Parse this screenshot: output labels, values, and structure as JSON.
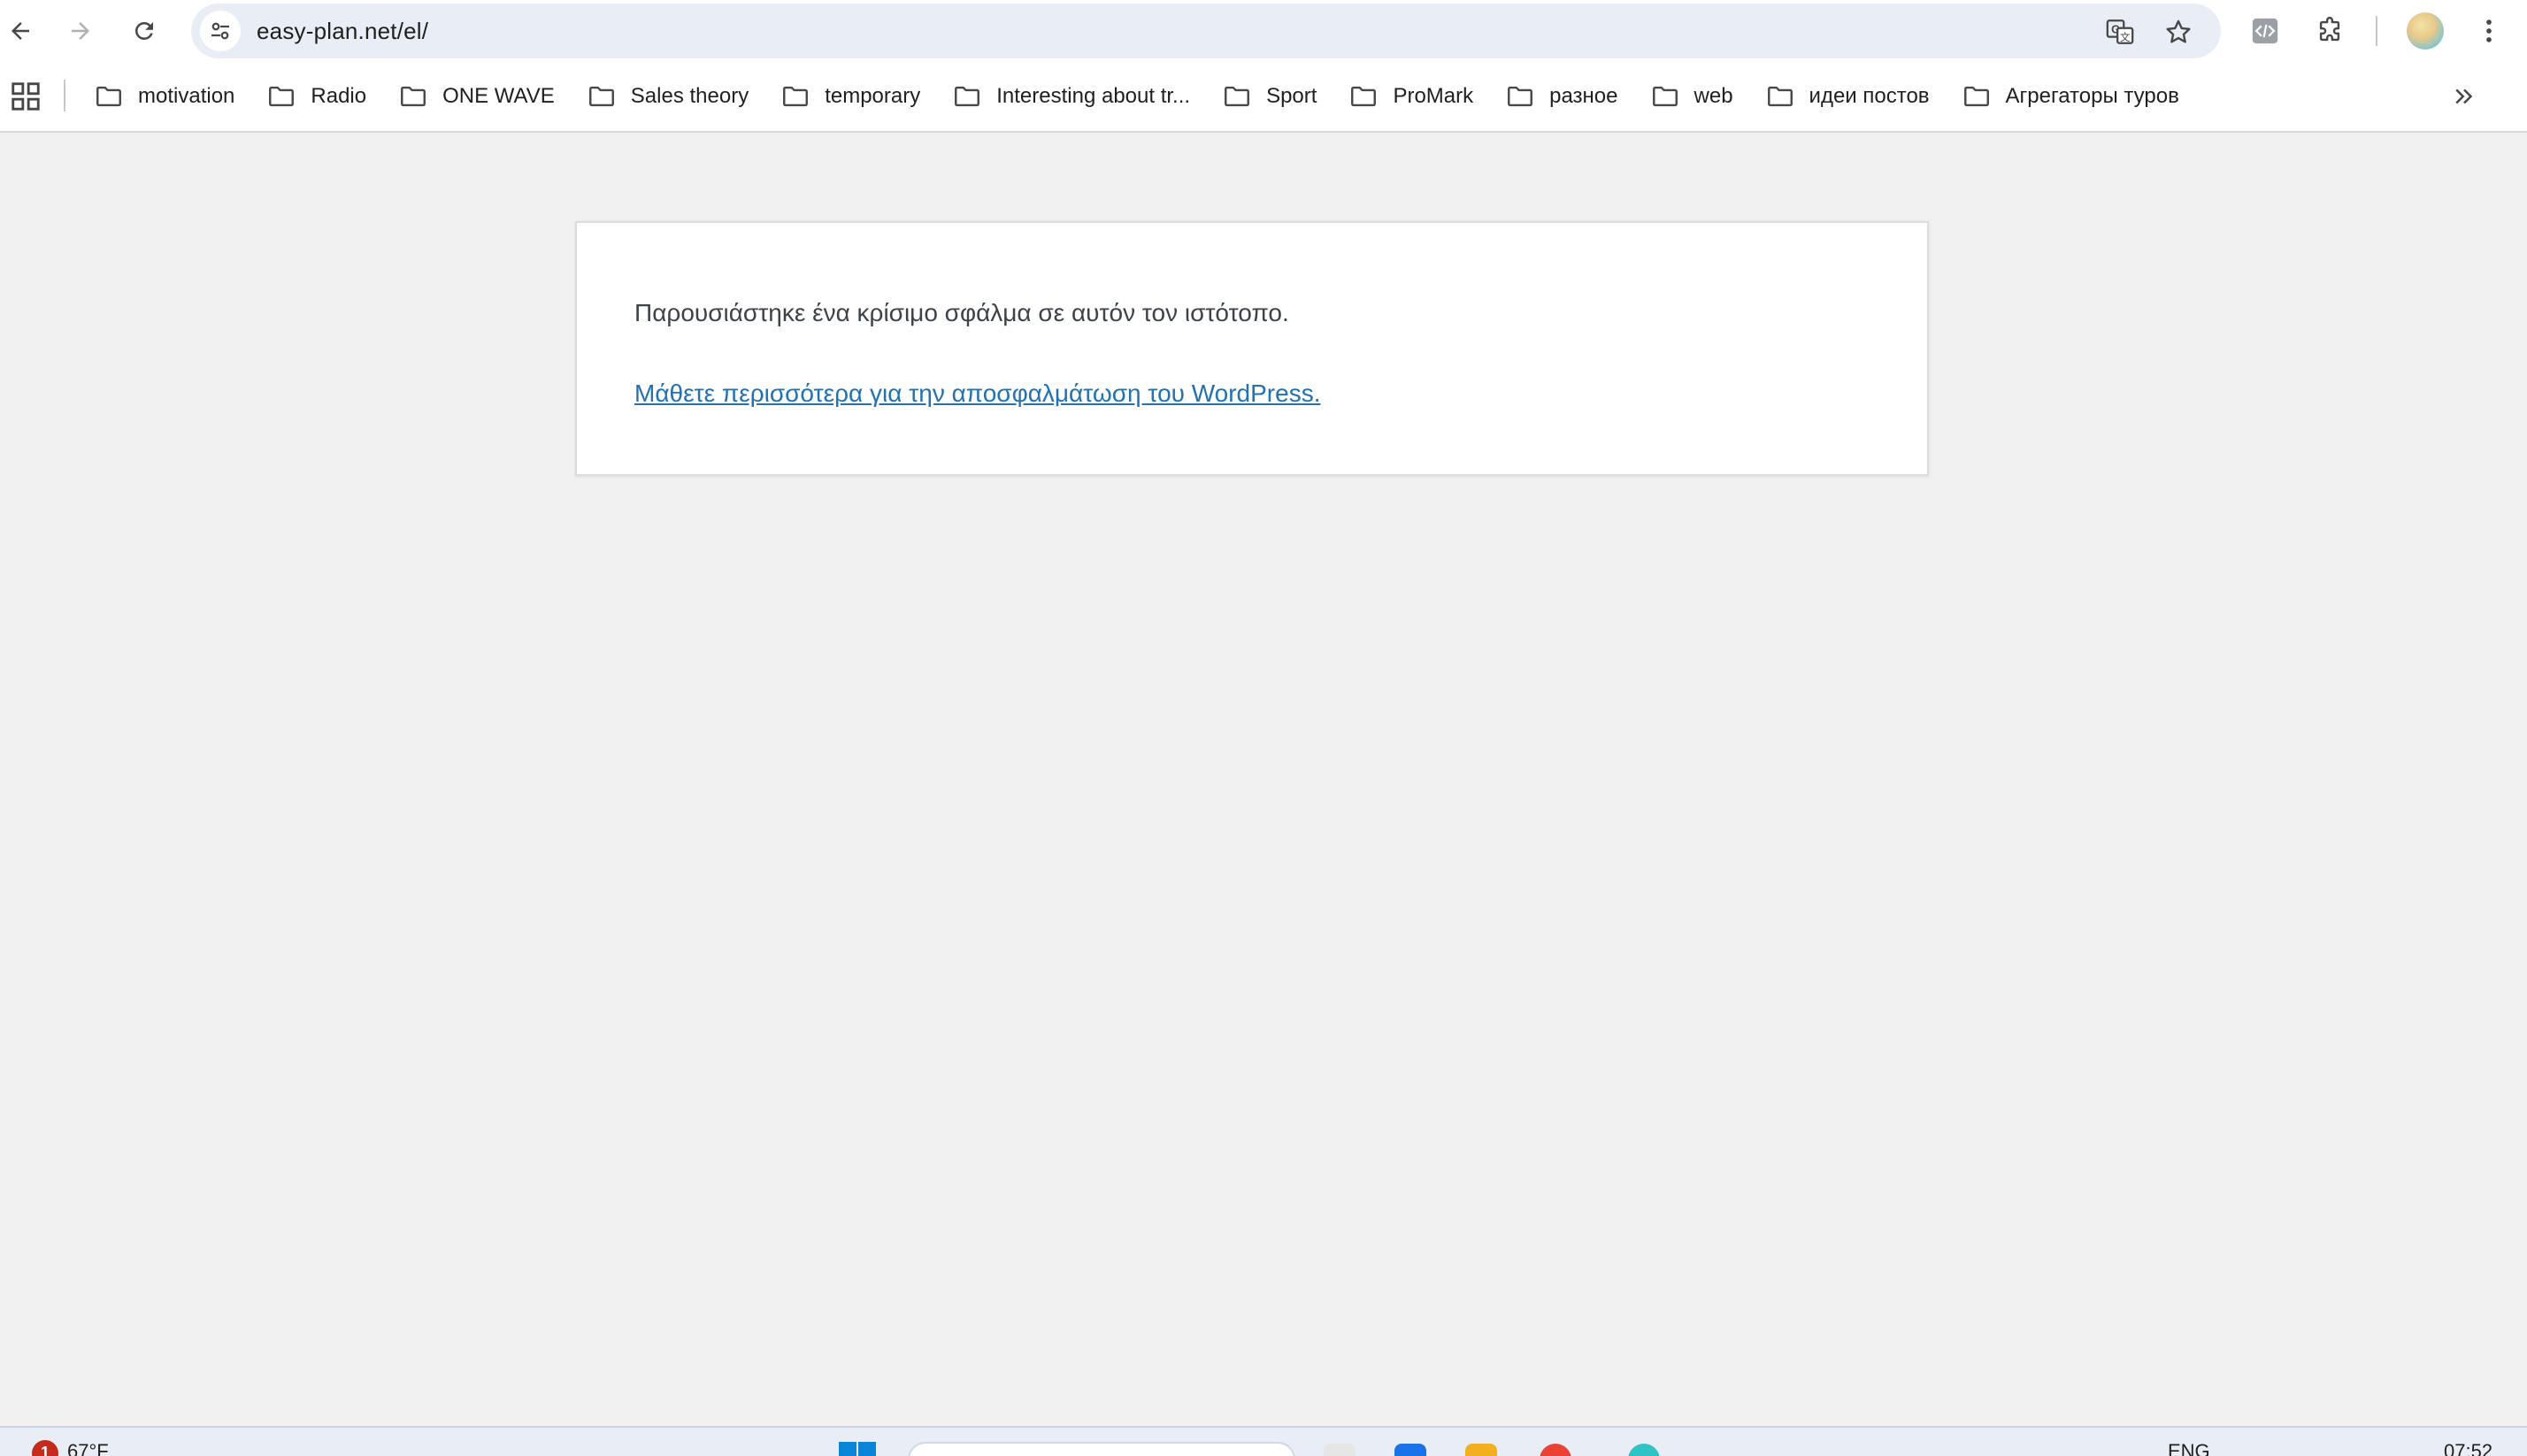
{
  "browser": {
    "url": "easy-plan.net/el/",
    "icons": {
      "back": "arrow-left-icon",
      "forward": "arrow-right-icon",
      "reload": "reload-icon",
      "site_info": "tune-icon",
      "translate": "translate-icon",
      "bookmark": "star-icon",
      "devtools": "code-icon",
      "extensions": "puzzle-icon",
      "menu": "kebab-menu-icon"
    }
  },
  "bookmarks": {
    "items": [
      {
        "label": "motivation"
      },
      {
        "label": "Radio"
      },
      {
        "label": "ONE WAVE"
      },
      {
        "label": "Sales theory"
      },
      {
        "label": "temporary"
      },
      {
        "label": "Interesting about tr..."
      },
      {
        "label": "Sport"
      },
      {
        "label": "ProMark"
      },
      {
        "label": "разное"
      },
      {
        "label": "web"
      },
      {
        "label": "идеи постов"
      },
      {
        "label": "Агрегаторы туров"
      }
    ]
  },
  "page": {
    "error_message": "Παρουσιάστηκε ένα κρίσιμο σφάλμα σε αυτόν τον ιστότοπο.",
    "link_text": "Μάθετε περισσότερα για την αποσφαλμάτωση του WordPress.",
    "link_color": "#2271b1"
  },
  "taskbar": {
    "notification_count": "1",
    "weather": "67°F",
    "language": "ENG",
    "time": "07:52"
  }
}
